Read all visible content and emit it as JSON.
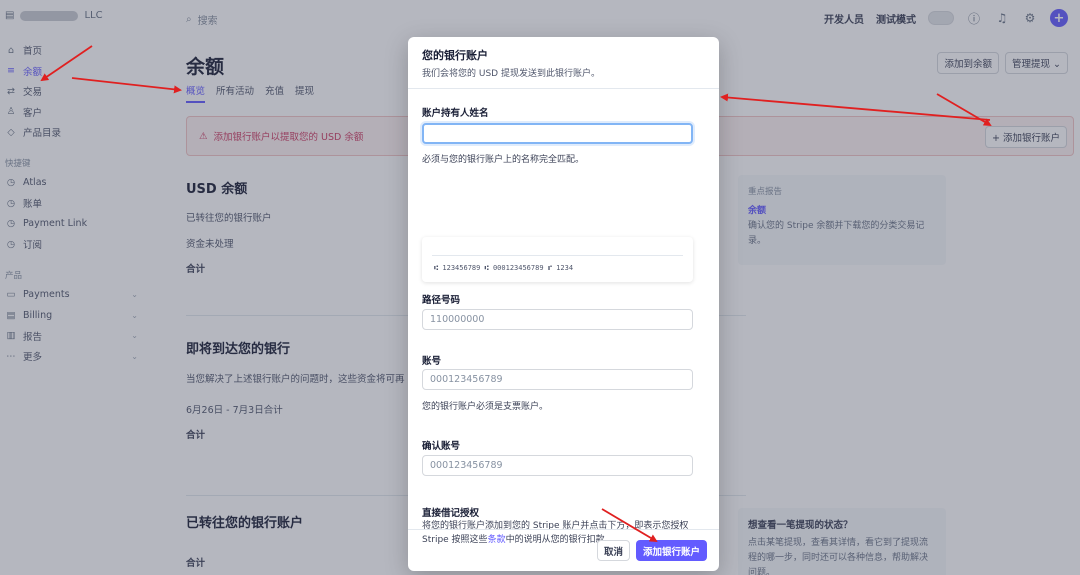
{
  "brand": {
    "suffix": "LLC"
  },
  "search": {
    "placeholder": "搜索"
  },
  "topbar": {
    "dev": "开发人员",
    "test_mode": "测试模式"
  },
  "sidebar": {
    "items": [
      {
        "label": "首页",
        "icon": "home-icon"
      },
      {
        "label": "余额",
        "icon": "balance-icon"
      },
      {
        "label": "交易",
        "icon": "transactions-icon"
      },
      {
        "label": "客户",
        "icon": "customer-icon"
      },
      {
        "label": "产品目录",
        "icon": "product-icon"
      }
    ],
    "shortcuts_label": "快捷键",
    "shortcuts": [
      "Atlas",
      "账单",
      "Payment Link",
      "订阅"
    ],
    "products_label": "产品",
    "products": [
      "Payments",
      "Billing",
      "报告",
      "更多"
    ]
  },
  "page": {
    "title": "余额",
    "add_balance": "添加到余额",
    "manage_payouts": "管理提现",
    "tabs": [
      "概览",
      "所有活动",
      "充值",
      "提现"
    ],
    "alert": "添加银行账户以提取您的 USD 余额",
    "add_bank": "添加银行账户",
    "usd_title": "USD 余额",
    "usd_rows": [
      "已转往您的银行账户",
      "资金未处理",
      "合计"
    ],
    "upcoming_title": "即将到达您的银行",
    "upcoming_desc": "当您解决了上述银行账户的问题时，这些资金将可再",
    "upcoming_range": "6月26日 - 7月3日合计",
    "upcoming_total": "合计",
    "transferred_title": "已转往您的银行账户",
    "transferred_total": "合计"
  },
  "cards": {
    "report_title": "重点报告",
    "report_link": "余额",
    "report_desc": "确认您的 Stripe 余额并下载您的分类交易记录。",
    "payout_h": "想查看一笔提现的状态？",
    "payout_desc": "点击某笔提现，查看其详情，看它到了提现流程的哪一步，同时还可以各种信息，帮助解决问题。"
  },
  "modal": {
    "title": "您的银行账户",
    "subtitle": "我们会将您的 USD 提现发送到此银行账户。",
    "holder_label": "账户持有人姓名",
    "holder_help": "必须与您的银行账户上的名称完全匹配。",
    "check_micr": "⑆ 123456789 ⑆ 000123456789 ⑈ 1234",
    "routing_label": "路径号码",
    "routing_placeholder": "110000000",
    "account_label": "账号",
    "account_placeholder": "000123456789",
    "account_help": "您的银行账户必须是支票账户。",
    "confirm_label": "确认账号",
    "confirm_placeholder": "000123456789",
    "mandate_title": "直接借记授权",
    "mandate_pre": "将您的银行账户添加到您的 Stripe 账户并点击下方，即表示您授权 Stripe 按照这些",
    "mandate_link": "条款",
    "mandate_post": "中的说明从您的银行扣款。",
    "cancel": "取消",
    "submit": "添加银行账户"
  }
}
